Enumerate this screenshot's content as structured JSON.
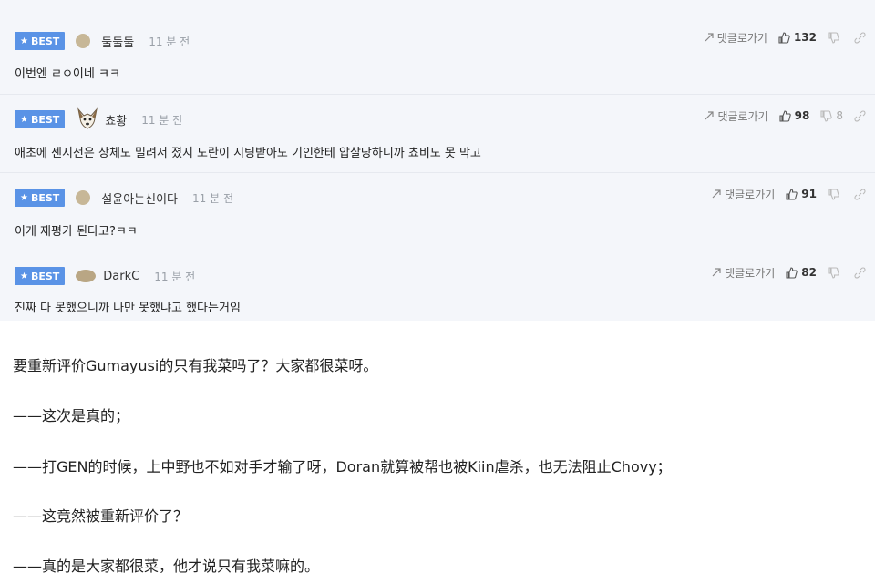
{
  "comments": [
    {
      "badge": "BEST",
      "nick": "둘둘둘",
      "time": "11 분 전",
      "text": "이번엔 ㄹㅇ이네 ㅋㅋ",
      "reply": "댓글로가기",
      "likes": "132",
      "dislikes": ""
    },
    {
      "badge": "BEST",
      "nick": "쵸황",
      "time": "11 분 전",
      "text": "애초에 젠지전은 상체도 밀려서 졌지 도란이 시팅받아도 기인한테 압살당하니까 쵸비도 못 막고",
      "reply": "댓글로가기",
      "likes": "98",
      "dislikes": "8"
    },
    {
      "badge": "BEST",
      "nick": "설윤아는신이다",
      "time": "11 분 전",
      "text": "이게 재평가 된다고?ㅋㅋ",
      "reply": "댓글로가기",
      "likes": "91",
      "dislikes": ""
    },
    {
      "badge": "BEST",
      "nick": "DarkC",
      "time": "11 분 전",
      "text": "진짜 다 못했으니까 나만 못했냐고 했다는거임",
      "reply": "댓글로가기",
      "likes": "82",
      "dislikes": ""
    }
  ],
  "article": {
    "paragraphs": [
      "要重新评价Gumayusi的只有我菜吗了？大家都很菜呀。",
      "——这次是真的；",
      "——打GEN的时候，上中野也不如对手才输了呀，Doran就算被帮也被Kiin虐杀，也无法阻止Chovy；",
      "——这竟然被重新评价了？",
      "——真的是大家都很菜，他才说只有我菜嘛的。"
    ]
  },
  "icons": {
    "reply": "reply-arrow-icon",
    "like": "thumbs-up-icon",
    "dislike": "thumbs-down-icon",
    "share": "link-icon",
    "badge": "star-icon"
  },
  "colors": {
    "badge": "#5a93e6",
    "panel": "#f4f6fa"
  }
}
